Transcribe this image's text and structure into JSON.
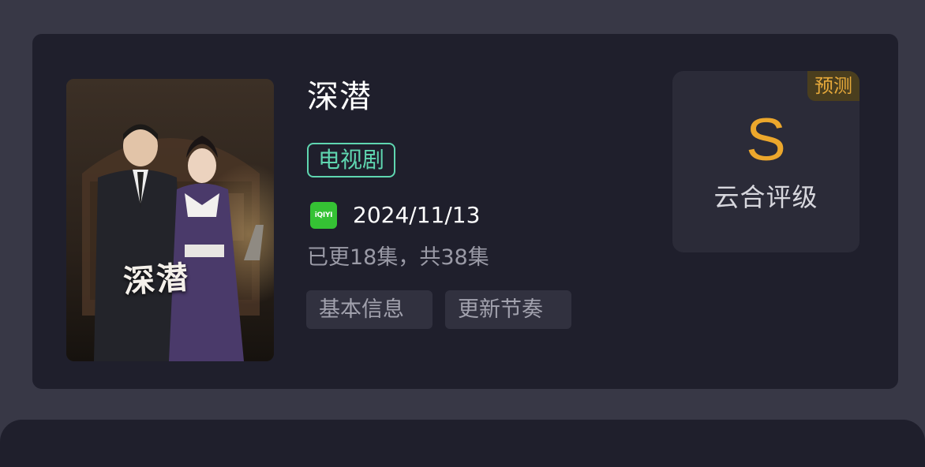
{
  "show": {
    "title": "深潜",
    "type_tag": "电视剧",
    "poster_title": "深潜",
    "platform": {
      "name": "iQIYI",
      "icon": "iqiyi-logo-icon",
      "color": "#35c234"
    },
    "date": "2024/11/13",
    "episodes": "已更18集，共38集",
    "buttons": {
      "basic_info": "基本信息",
      "update_rhythm": "更新节奏"
    }
  },
  "rating": {
    "badge": "预测",
    "grade": "S",
    "label": "云合评级",
    "grade_color": "#eca72c"
  },
  "colors": {
    "background": "#383846",
    "card": "#1f1f2c",
    "accent_green": "#5fd6b0"
  }
}
